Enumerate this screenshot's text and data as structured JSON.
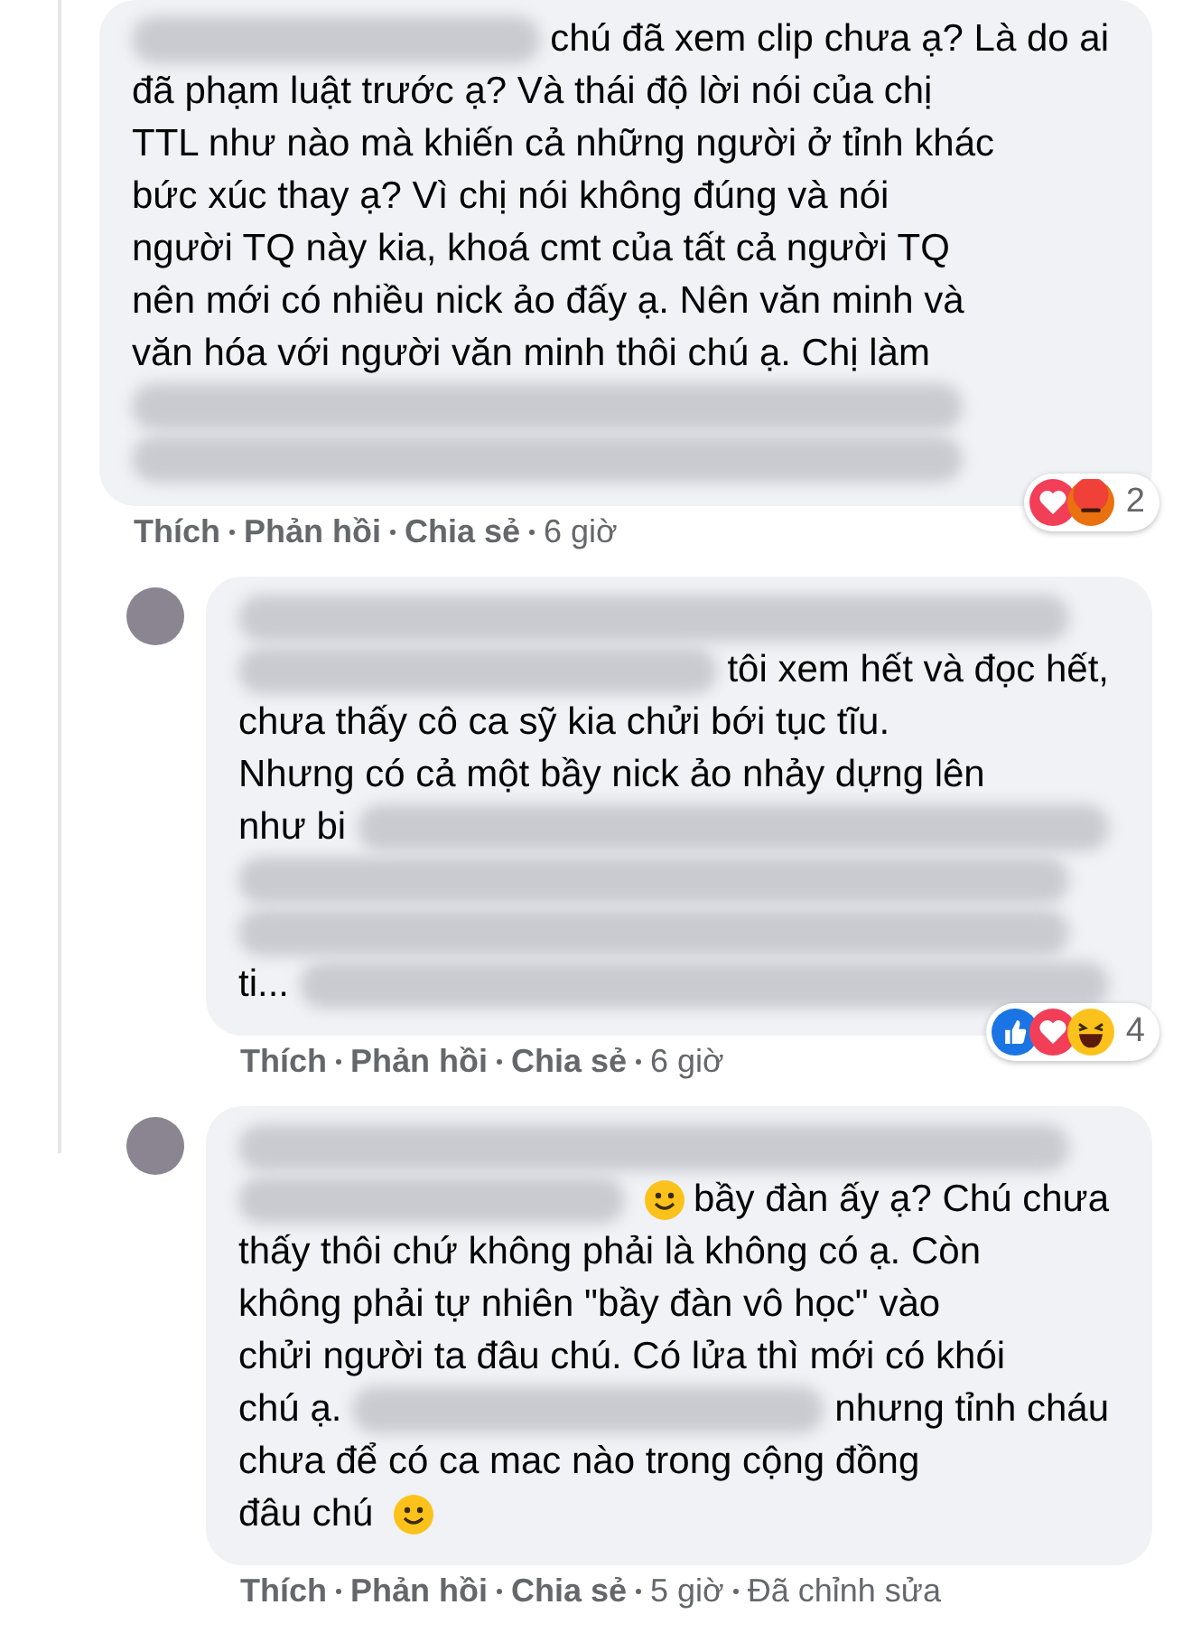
{
  "comments": [
    {
      "reply": false,
      "lines": [
        [
          {
            "kind": "blur"
          },
          {
            "kind": "text",
            "text": "chú đã xem clip chưa ạ? Là do ai"
          }
        ],
        [
          {
            "kind": "text",
            "text": "đã phạm luật trước ạ? Và thái độ lời nói của chị"
          }
        ],
        [
          {
            "kind": "text",
            "text": "TTL như nào mà khiến cả những người ở tỉnh khác"
          }
        ],
        [
          {
            "kind": "text",
            "text": "bức xúc thay ạ? Vì chị nói không đúng và nói"
          }
        ],
        [
          {
            "kind": "text",
            "text": "người TQ này kia, khoá cmt của tất cả người TQ"
          }
        ],
        [
          {
            "kind": "text",
            "text": "nên mới có nhiều nick ảo đấy ạ. Nên văn minh và"
          }
        ],
        [
          {
            "kind": "text",
            "text": "văn hóa với người văn minh thôi chú ạ. Chị làm"
          }
        ],
        [
          {
            "kind": "blur"
          }
        ],
        [
          {
            "kind": "blur"
          }
        ]
      ],
      "reactions": [
        {
          "kind": "love"
        },
        {
          "kind": "angry"
        }
      ],
      "reaction_count": "2",
      "actions": [
        "Thích",
        "Phản hồi",
        "Chia sẻ",
        "6 giờ"
      ]
    },
    {
      "reply": true,
      "lines": [
        [
          {
            "kind": "blur"
          }
        ],
        [
          {
            "kind": "blur"
          },
          {
            "kind": "text",
            "text": "tôi xem hết và đọc hết,"
          }
        ],
        [
          {
            "kind": "text",
            "text": "chưa thấy cô ca sỹ kia chửi bới tục tĩu."
          }
        ],
        [
          {
            "kind": "text",
            "text": "Nhưng có cả một bầy nick ảo nhảy dựng lên"
          }
        ],
        [
          {
            "kind": "text",
            "text": "như bi"
          },
          {
            "kind": "blur"
          }
        ],
        [
          {
            "kind": "blur"
          }
        ],
        [
          {
            "kind": "blur"
          }
        ],
        [
          {
            "kind": "text",
            "text": "ti..."
          },
          {
            "kind": "blur"
          }
        ]
      ],
      "reactions": [
        {
          "kind": "like"
        },
        {
          "kind": "love"
        },
        {
          "kind": "haha"
        }
      ],
      "reaction_count": "4",
      "actions": [
        "Thích",
        "Phản hồi",
        "Chia sẻ",
        "6 giờ"
      ]
    },
    {
      "reply": true,
      "lines": [
        [
          {
            "kind": "blur"
          }
        ],
        [
          {
            "kind": "blur"
          },
          {
            "kind": "emoji"
          },
          {
            "kind": "text",
            "text": "bầy đàn ấy ạ? Chú chưa"
          }
        ],
        [
          {
            "kind": "text",
            "text": "thấy thôi chứ không phải là không có ạ. Còn"
          }
        ],
        [
          {
            "kind": "text",
            "text": "không phải tự nhiên \"bầy đàn vô học\" vào"
          }
        ],
        [
          {
            "kind": "text",
            "text": "chửi người ta đâu chú. Có lửa thì mới có khói"
          }
        ],
        [
          {
            "kind": "text",
            "text": "chú ạ."
          },
          {
            "kind": "blur"
          },
          {
            "kind": "text",
            "text": "nhưng tỉnh cháu"
          }
        ],
        [
          {
            "kind": "text",
            "text": "chưa để có ca mac nào trong cộng đồng"
          }
        ],
        [
          {
            "kind": "text",
            "text": "đâu chú"
          },
          {
            "kind": "emoji"
          }
        ]
      ],
      "actions": [
        "Thích",
        "Phản hồi",
        "Chia sẻ",
        "5 giờ",
        "Đã chỉnh sửa"
      ]
    }
  ]
}
